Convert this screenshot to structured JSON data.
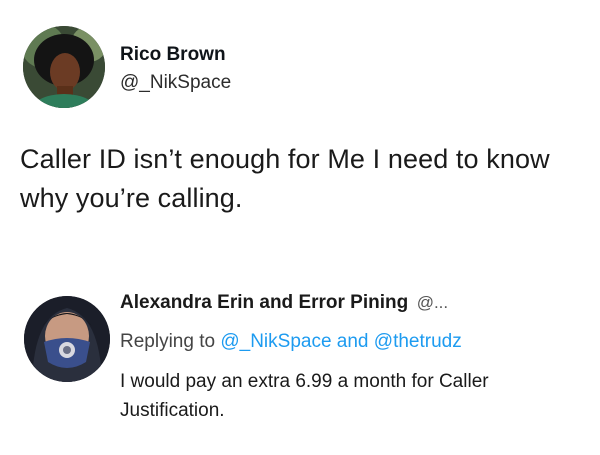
{
  "tweet": {
    "author_name": "Rico Brown",
    "author_handle": "@_NikSpace",
    "text": "Caller ID isn’t enough for Me I need to know why you’re calling."
  },
  "reply": {
    "author_name": "Alexandra Erin and Error Pining",
    "author_handle": "@...",
    "replying_to_prefix": "Replying to",
    "mention_1": "@_NikSpace",
    "conjunction": "and",
    "mention_2": "@thetrudz",
    "text": "I would pay an extra 6.99 a month for Caller Justification."
  },
  "colors": {
    "mention": "#1d9bf0",
    "text": "#0f1419"
  }
}
